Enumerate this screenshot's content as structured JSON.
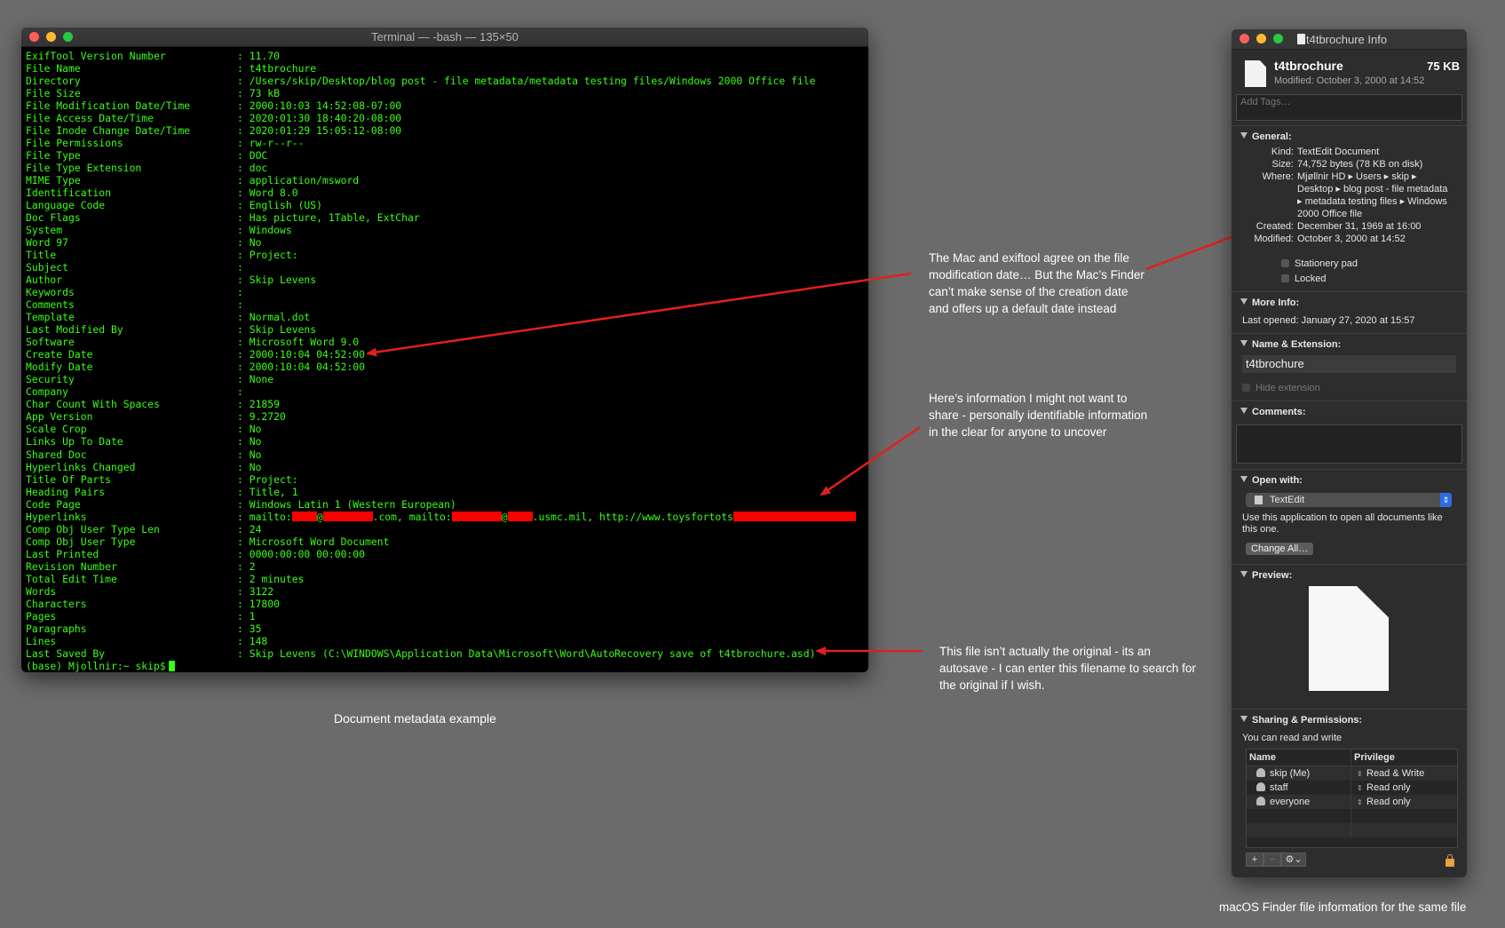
{
  "terminal": {
    "title": "Terminal — -bash — 135×50",
    "rows": [
      {
        "k": "ExifTool Version Number",
        "v": ": 11.70"
      },
      {
        "k": "File Name",
        "v": ": t4tbrochure"
      },
      {
        "k": "Directory",
        "v": ": /Users/skip/Desktop/blog post - file metadata/metadata testing files/Windows 2000 Office file"
      },
      {
        "k": "File Size",
        "v": ": 73 kB"
      },
      {
        "k": "File Modification Date/Time",
        "v": ": 2000:10:03 14:52:08-07:00"
      },
      {
        "k": "File Access Date/Time",
        "v": ": 2020:01:30 18:40:20-08:00"
      },
      {
        "k": "File Inode Change Date/Time",
        "v": ": 2020:01:29 15:05:12-08:00"
      },
      {
        "k": "File Permissions",
        "v": ": rw-r--r--"
      },
      {
        "k": "File Type",
        "v": ": DOC"
      },
      {
        "k": "File Type Extension",
        "v": ": doc"
      },
      {
        "k": "MIME Type",
        "v": ": application/msword"
      },
      {
        "k": "Identification",
        "v": ": Word 8.0"
      },
      {
        "k": "Language Code",
        "v": ": English (US)"
      },
      {
        "k": "Doc Flags",
        "v": ": Has picture, 1Table, ExtChar"
      },
      {
        "k": "System",
        "v": ": Windows"
      },
      {
        "k": "Word 97",
        "v": ": No"
      },
      {
        "k": "Title",
        "v": ": Project:"
      },
      {
        "k": "Subject",
        "v": ":"
      },
      {
        "k": "Author",
        "v": ": Skip Levens"
      },
      {
        "k": "Keywords",
        "v": ":"
      },
      {
        "k": "Comments",
        "v": ":"
      },
      {
        "k": "Template",
        "v": ": Normal.dot"
      },
      {
        "k": "Last Modified By",
        "v": ": Skip Levens"
      },
      {
        "k": "Software",
        "v": ": Microsoft Word 9.0"
      },
      {
        "k": "Create Date",
        "v": ": 2000:10:04 04:52:00"
      },
      {
        "k": "Modify Date",
        "v": ": 2000:10:04 04:52:00"
      },
      {
        "k": "Security",
        "v": ": None"
      },
      {
        "k": "Company",
        "v": ":"
      },
      {
        "k": "Char Count With Spaces",
        "v": ": 21859"
      },
      {
        "k": "App Version",
        "v": ": 9.2720"
      },
      {
        "k": "Scale Crop",
        "v": ": No"
      },
      {
        "k": "Links Up To Date",
        "v": ": No"
      },
      {
        "k": "Shared Doc",
        "v": ": No"
      },
      {
        "k": "Hyperlinks Changed",
        "v": ": No"
      },
      {
        "k": "Title Of Parts",
        "v": ": Project:"
      },
      {
        "k": "Heading Pairs",
        "v": ": Title, 1"
      },
      {
        "k": "Code Page",
        "v": ": Windows Latin 1 (Western European)"
      }
    ],
    "hyperlinks": {
      "k": "Hyperlinks",
      "p1": ": mailto:",
      "p2": "@",
      "p3": ".com, mailto:",
      "p4": "@",
      "p5": ".usmc.mil, http://www.toysfortots"
    },
    "rows2": [
      {
        "k": "Comp Obj User Type Len",
        "v": ": 24"
      },
      {
        "k": "Comp Obj User Type",
        "v": ": Microsoft Word Document"
      },
      {
        "k": "Last Printed",
        "v": ": 0000:00:00 00:00:00"
      },
      {
        "k": "Revision Number",
        "v": ": 2"
      },
      {
        "k": "Total Edit Time",
        "v": ": 2 minutes"
      },
      {
        "k": "Words",
        "v": ": 3122"
      },
      {
        "k": "Characters",
        "v": ": 17800"
      },
      {
        "k": "Pages",
        "v": ": 1"
      },
      {
        "k": "Paragraphs",
        "v": ": 35"
      },
      {
        "k": "Lines",
        "v": ": 148"
      },
      {
        "k": "Last Saved By",
        "v": ": Skip Levens (C:\\WINDOWS\\Application Data\\Microsoft\\Word\\AutoRecovery save of t4tbrochure.asd)"
      }
    ],
    "prompt": "(base) Mjollnir:~ skip$"
  },
  "captions": {
    "terminal": "Document metadata example",
    "finder": "macOS Finder file information for the same file"
  },
  "notes": {
    "n1": "The Mac and exiftool agree on the file modification date… But the Mac’s Finder can’t make sense of the creation date and offers up a default date instead",
    "n2": "Here’s information I might not want to share - personally identifiable information in the clear for anyone to uncover",
    "n3": "This file isn’t actually the original - its an autosave - I can enter this filename to search for the original if I wish."
  },
  "annotation_color": "#e0201e",
  "info": {
    "title": "t4tbrochure Info",
    "name": "t4tbrochure",
    "size": "75 KB",
    "modified": "Modified: October 3, 2000 at 14:52",
    "tags_placeholder": "Add Tags…",
    "general": {
      "header": "General:",
      "kind_k": "Kind:",
      "kind_v": "TextEdit Document",
      "size_k": "Size:",
      "size_v": "74,752 bytes (78 KB on disk)",
      "where_k": "Where:",
      "where_v": "Mjøllnir HD ▸ Users ▸ skip ▸ Desktop ▸ blog post - file metadata ▸ metadata testing files ▸ Windows 2000 Office file",
      "created_k": "Created:",
      "created_v": "December 31, 1969 at 16:00",
      "modified_k": "Modified:",
      "modified_v": "October 3, 2000 at 14:52",
      "stationery": "Stationery pad",
      "locked": "Locked"
    },
    "more_info": {
      "header": "More Info:",
      "last_opened": "Last opened: January 27, 2020 at 15:57"
    },
    "name_ext": {
      "header": "Name & Extension:",
      "value": "t4tbrochure",
      "hide": "Hide extension"
    },
    "comments": {
      "header": "Comments:"
    },
    "open_with": {
      "header": "Open with:",
      "app": "TextEdit",
      "desc": "Use this application to open all documents like this one.",
      "button": "Change All…"
    },
    "preview": {
      "header": "Preview:"
    },
    "sharing": {
      "header": "Sharing & Permissions:",
      "desc": "You can read and write",
      "col_name": "Name",
      "col_priv": "Privilege",
      "rows": [
        {
          "name": "skip (Me)",
          "priv": "Read & Write"
        },
        {
          "name": "staff",
          "priv": "Read only"
        },
        {
          "name": "everyone",
          "priv": "Read only"
        }
      ]
    },
    "footer": {
      "add": "+",
      "remove": "−",
      "gear": "⚙⌄"
    }
  }
}
